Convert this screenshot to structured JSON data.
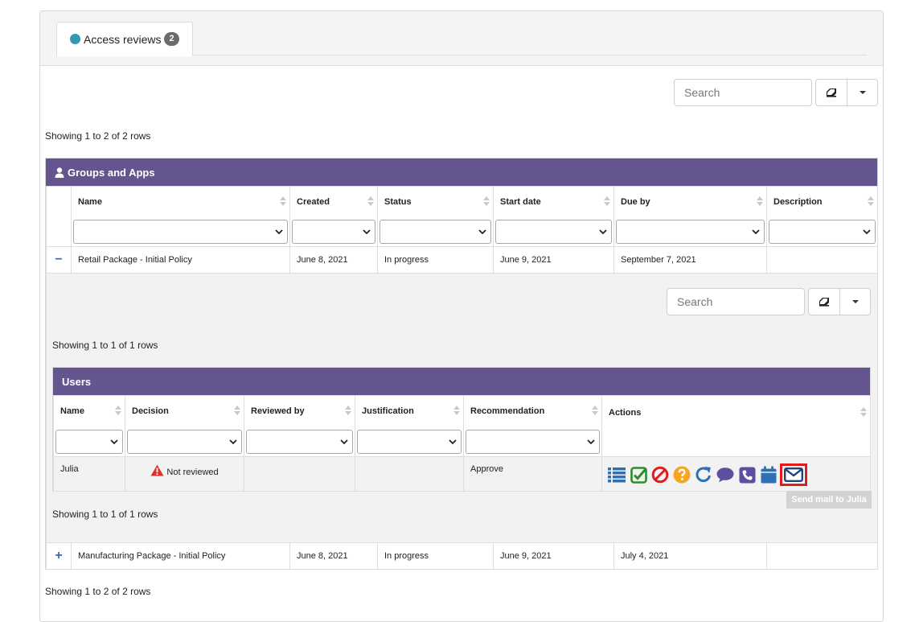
{
  "tabs": [
    {
      "label": "Access reviews",
      "badge": "2"
    }
  ],
  "outer_search": {
    "placeholder": "Search"
  },
  "outer_info_top": "Showing 1 to 2 of 2 rows",
  "groups": {
    "title": "Groups and Apps",
    "columns": [
      "Name",
      "Created",
      "Status",
      "Start date",
      "Due by",
      "Description"
    ],
    "rows": [
      {
        "toggle": "−",
        "name": "Retail Package - Initial Policy",
        "created": "June 8, 2021",
        "status": "In progress",
        "start": "June 9, 2021",
        "due": "September 7, 2021",
        "description": ""
      },
      {
        "toggle": "+",
        "name": "Manufacturing Package - Initial Policy",
        "created": "June 8, 2021",
        "status": "In progress",
        "start": "June 9, 2021",
        "due": "July 4, 2021",
        "description": ""
      }
    ]
  },
  "inner_search": {
    "placeholder": "Search"
  },
  "inner_info_top": "Showing 1 to 1 of 1 rows",
  "users": {
    "title": "Users",
    "columns": [
      "Name",
      "Decision",
      "Reviewed by",
      "Justification",
      "Recommendation",
      "Actions"
    ],
    "rows": [
      {
        "name": "Julia",
        "decision": "Not reviewed",
        "reviewed_by": "",
        "justification": "",
        "recommendation": "Approve"
      }
    ],
    "actions": [
      "list-icon",
      "check-icon",
      "deny-icon",
      "question-icon",
      "refresh-icon",
      "comment-icon",
      "phone-icon",
      "calendar-icon",
      "envelope-icon"
    ]
  },
  "inner_info_bottom": "Showing 1 to 1 of 1 rows",
  "tooltip": "Send mail to Julia",
  "outer_info_bottom": "Showing 1 to 2 of 2 rows",
  "colors": {
    "header_purple": "#65558f",
    "tab_dot": "#3197b2",
    "highlight_red": "#e41b1b",
    "warning_red": "#d9342b",
    "check_green": "#2e8b2e",
    "question_orange": "#f5a623",
    "icon_blue": "#2f6fb3",
    "icon_purple": "#5b4fa0"
  }
}
